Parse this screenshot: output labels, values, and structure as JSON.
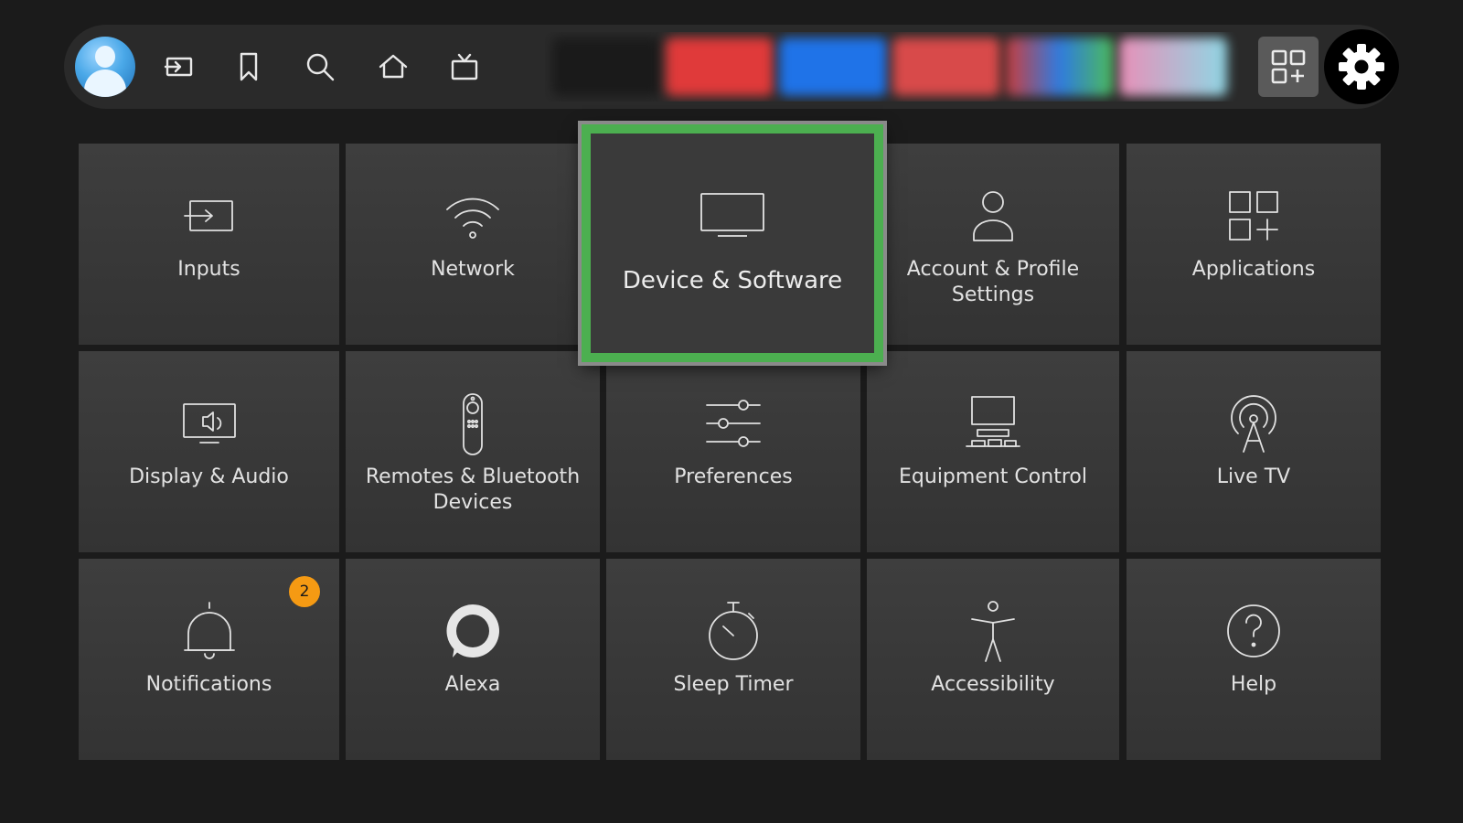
{
  "topbar": {
    "nav": [
      {
        "icon": "profile-avatar"
      },
      {
        "icon": "input-icon"
      },
      {
        "icon": "bookmark-icon"
      },
      {
        "icon": "search-icon"
      },
      {
        "icon": "home-icon"
      },
      {
        "icon": "live-tv-icon"
      }
    ],
    "apps_button_icon": "apps-grid-icon",
    "settings_button_icon": "gear-icon"
  },
  "tiles": [
    {
      "label": "Inputs",
      "icon": "input-icon"
    },
    {
      "label": "Network",
      "icon": "wifi-icon"
    },
    {
      "label": "Device & Software",
      "icon": "tv-icon",
      "focused": true
    },
    {
      "label": "Account & Profile Settings",
      "icon": "person-icon"
    },
    {
      "label": "Applications",
      "icon": "apps-grid-icon"
    },
    {
      "label": "Display & Audio",
      "icon": "display-audio-icon"
    },
    {
      "label": "Remotes & Bluetooth Devices",
      "icon": "remote-icon"
    },
    {
      "label": "Preferences",
      "icon": "sliders-icon"
    },
    {
      "label": "Equipment Control",
      "icon": "equipment-icon"
    },
    {
      "label": "Live TV",
      "icon": "antenna-icon"
    },
    {
      "label": "Notifications",
      "icon": "bell-icon",
      "badge": "2"
    },
    {
      "label": "Alexa",
      "icon": "alexa-icon"
    },
    {
      "label": "Sleep Timer",
      "icon": "timer-icon"
    },
    {
      "label": "Accessibility",
      "icon": "accessibility-icon"
    },
    {
      "label": "Help",
      "icon": "help-icon"
    }
  ],
  "colors": {
    "focus": "#4caf50",
    "badge": "#f59a13",
    "background": "#1b1b1b"
  }
}
